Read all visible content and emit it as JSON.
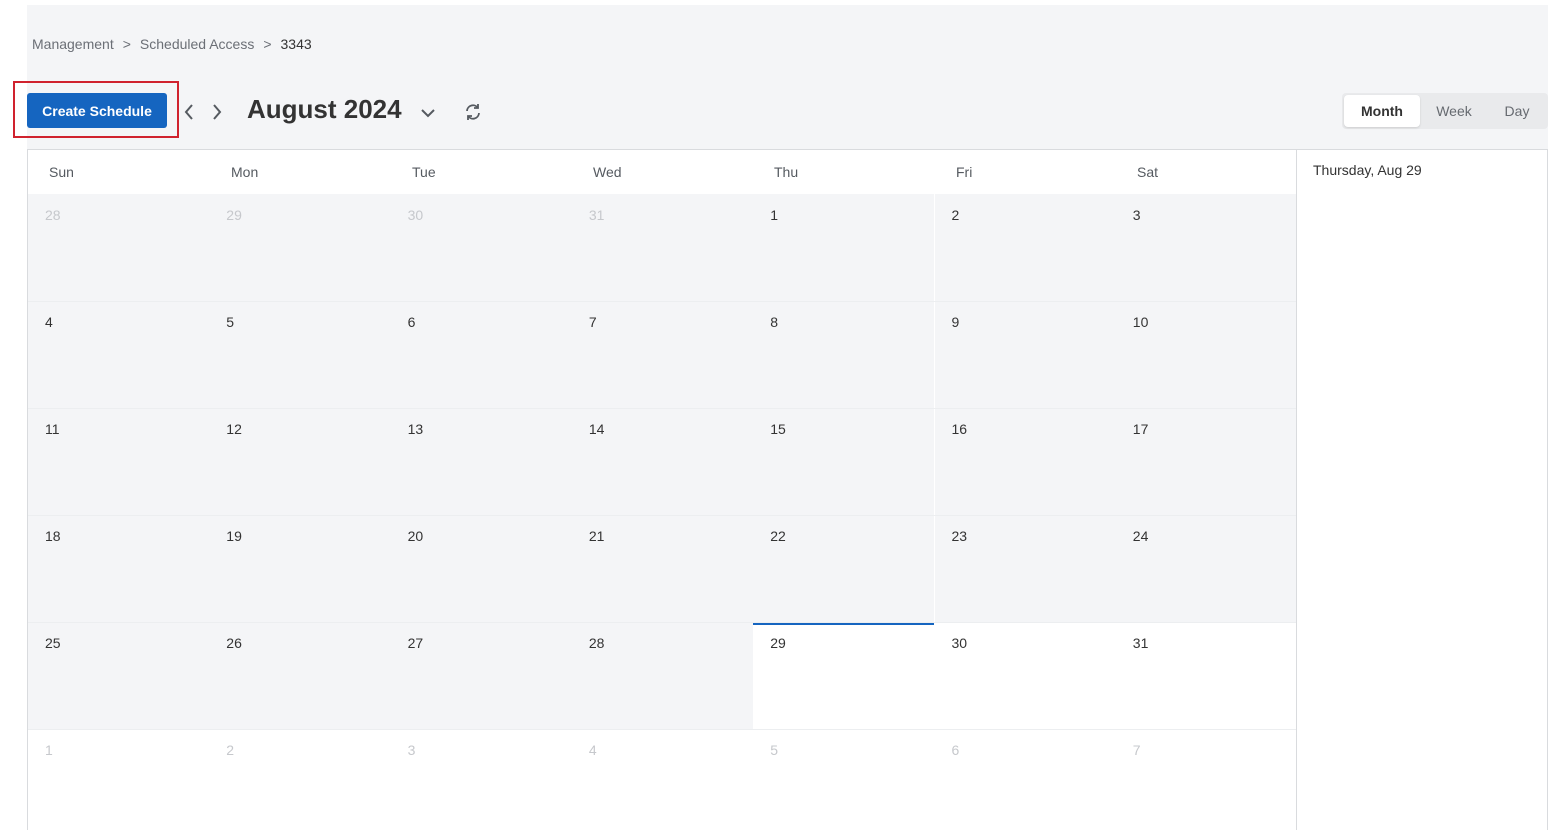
{
  "breadcrumb": {
    "items": [
      "Management",
      "Scheduled Access",
      "3343"
    ],
    "separator": ">"
  },
  "toolbar": {
    "create_label": "Create Schedule",
    "prev_icon": "chevron-left-icon",
    "next_icon": "chevron-right-icon",
    "month_title": "August 2024",
    "dropdown_icon": "chevron-down-icon",
    "refresh_icon": "refresh-icon"
  },
  "view_switch": {
    "options": [
      "Month",
      "Week",
      "Day"
    ],
    "selected": "Month"
  },
  "calendar": {
    "weekdays": [
      "Sun",
      "Mon",
      "Tue",
      "Wed",
      "Thu",
      "Fri",
      "Sat"
    ],
    "weeks": [
      [
        28,
        29,
        30,
        31,
        1,
        2,
        3
      ],
      [
        4,
        5,
        6,
        7,
        8,
        9,
        10
      ],
      [
        11,
        12,
        13,
        14,
        15,
        16,
        17
      ],
      [
        18,
        19,
        20,
        21,
        22,
        23,
        24
      ],
      [
        25,
        26,
        27,
        28,
        29,
        30,
        31
      ],
      [
        1,
        2,
        3,
        4,
        5,
        6,
        7
      ]
    ],
    "today": 29
  },
  "side_panel": {
    "date_label": "Thursday, Aug 29"
  },
  "colors": {
    "accent": "#1565c0",
    "highlight_border": "#d0222e",
    "past_bg": "#f4f5f7"
  }
}
